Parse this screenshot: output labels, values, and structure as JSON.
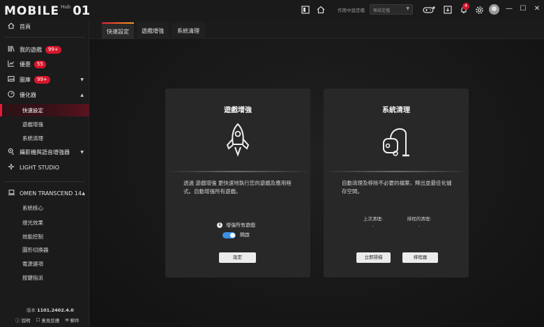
{
  "titlebar": {
    "logo_main": "MOBILE",
    "logo_hub": "Hub",
    "logo_suffix": "01",
    "mode_label": "作用中設定檔",
    "profile_placeholder": "無設定檔",
    "notification_count": "4"
  },
  "sidebar": {
    "home": "首頁",
    "my_games": "我的遊戲",
    "my_games_badge": "99+",
    "deals": "優惠",
    "deals_badge": "55",
    "gallery": "圖庫",
    "gallery_badge": "99+",
    "optimizer": "優化器",
    "optimizer_items": [
      "快速設定",
      "遊戲增強",
      "系統清理"
    ],
    "camera_enhancer": "攝影機與語音增強器",
    "light_studio": "LIGHT STUDIO",
    "device": "OMEN TRANSCEND 14",
    "device_items": [
      "系統核心",
      "燈光效果",
      "效能控制",
      "圖形切換器",
      "電源選項",
      "按鍵指派"
    ],
    "version_label": "版本",
    "version_number": "1101.2402.4.0",
    "footer": [
      "說明",
      "意見反應",
      "郵件"
    ]
  },
  "tabs": [
    "快速設定",
    "遊戲增強",
    "系統清理"
  ],
  "game_boost": {
    "title": "遊戲增強",
    "description": "透過 遊戲增強 更快速地執行您的遊戲及應用程式。自動增強所有遊戲。",
    "toggle_label": "增強所有遊戲",
    "toggle_state": "開啟",
    "settings_button": "設定"
  },
  "system_cleanup": {
    "title": "系統清理",
    "description": "自動清理及移除不必要的檔案，釋出並最佳化儲存空間。",
    "last_clean_label": "上次清理:",
    "last_clean_value": "-",
    "scheduled_label": "排程的清理:",
    "scheduled_value": "-",
    "clean_now_button": "立即掃描",
    "scheduler_button": "排程器"
  }
}
